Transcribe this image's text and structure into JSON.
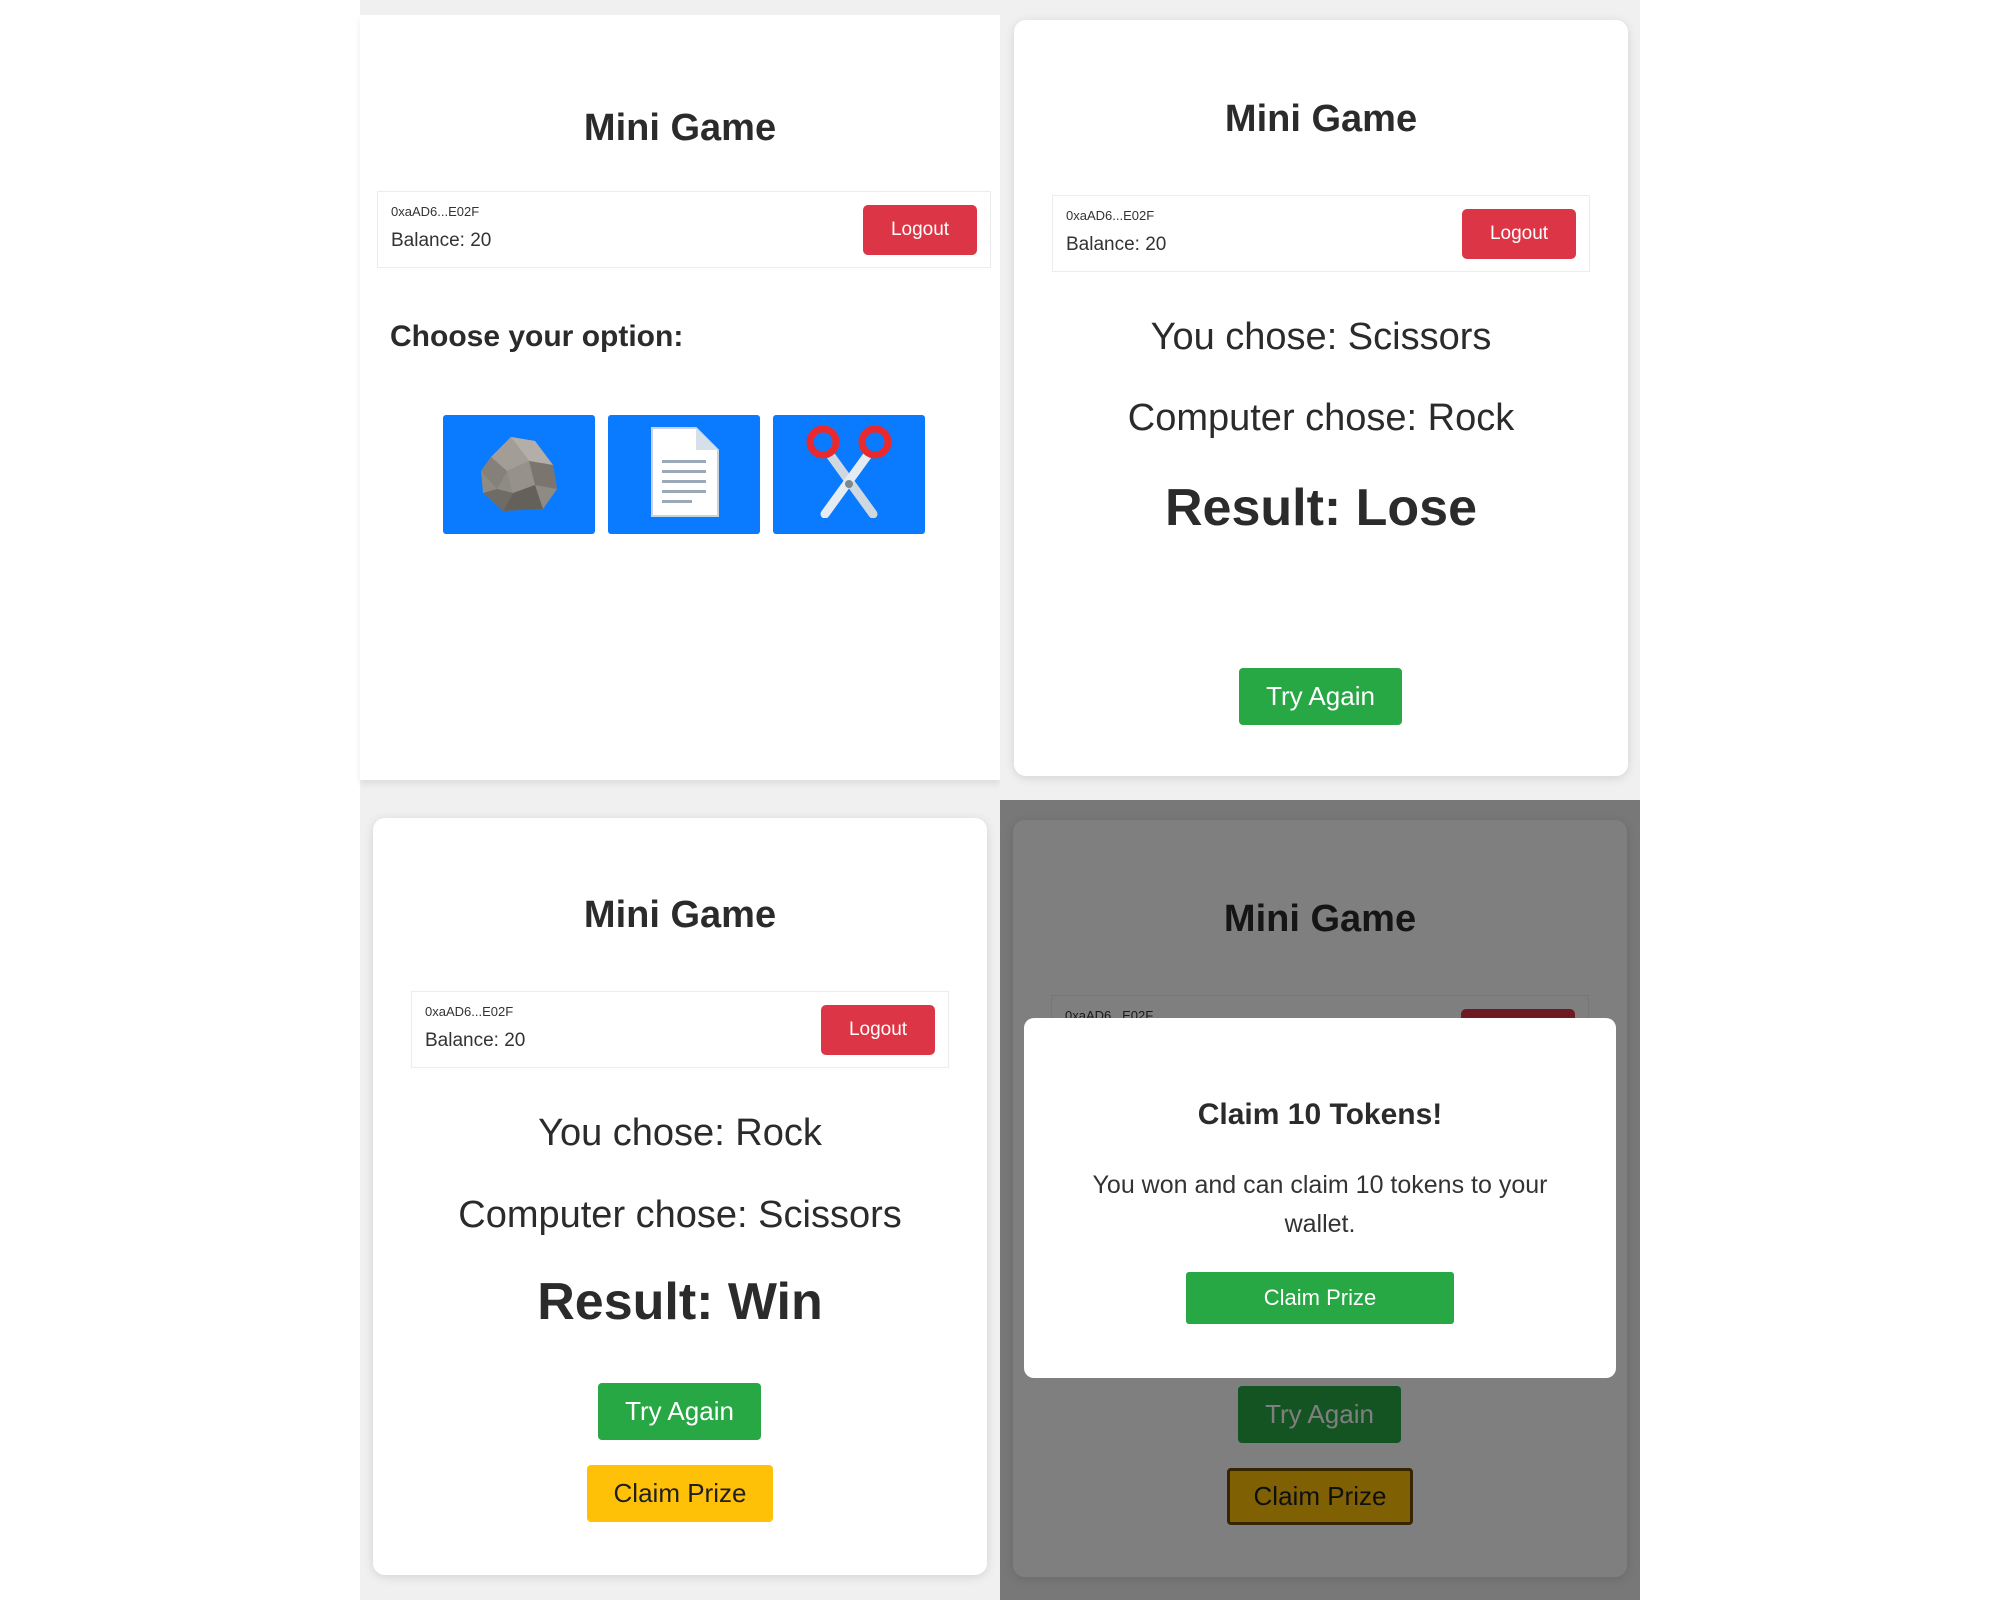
{
  "app": {
    "title": "Mini Game",
    "address": "0xaAD6...E02F",
    "balance_label": "Balance: 20",
    "logout_label": "Logout"
  },
  "select_screen": {
    "choose_label": "Choose your option:",
    "options": [
      {
        "name": "Rock",
        "icon": "rock-icon"
      },
      {
        "name": "Paper",
        "icon": "paper-icon"
      },
      {
        "name": "Scissors",
        "icon": "scissors-icon"
      }
    ]
  },
  "lose_screen": {
    "you_chose": "You chose: Scissors",
    "computer_chose": "Computer chose: Rock",
    "result": "Result: Lose",
    "try_again_label": "Try Again"
  },
  "win_screen": {
    "you_chose": "You chose: Rock",
    "computer_chose": "Computer chose: Scissors",
    "result": "Result: Win",
    "try_again_label": "Try Again",
    "claim_prize_label": "Claim Prize"
  },
  "claim_modal": {
    "title": "Claim 10 Tokens!",
    "message": "You won and can claim 10 tokens to your wallet.",
    "claim_button_label": "Claim Prize",
    "background_address": "0xaAD6...E02F"
  },
  "colors": {
    "primary_blue": "#0a7bff",
    "danger_red": "#dc3545",
    "success_green": "#28a745",
    "warning_yellow": "#ffc107",
    "overlay": "rgba(0,0,0,0.5)"
  }
}
